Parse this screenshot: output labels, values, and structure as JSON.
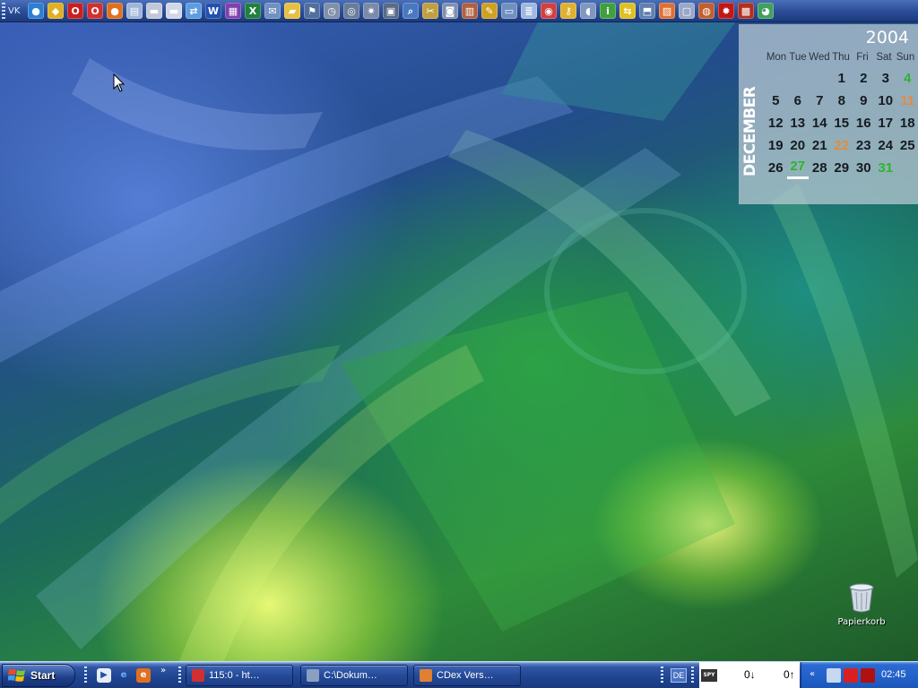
{
  "top_toolbar": {
    "label": "VK",
    "icons": [
      {
        "name": "globe-icon",
        "glyph": "●",
        "bg": "#2a7fd4"
      },
      {
        "name": "msn-icon",
        "glyph": "◆",
        "bg": "#e0b020"
      },
      {
        "name": "opera-icon",
        "glyph": "O",
        "bg": "#c82020"
      },
      {
        "name": "opera-alt-icon",
        "glyph": "O",
        "bg": "#d03030"
      },
      {
        "name": "firefox-icon",
        "glyph": "●",
        "bg": "#e07020"
      },
      {
        "name": "printer-icon",
        "glyph": "▤",
        "bg": "#9fb4d8"
      },
      {
        "name": "drive-icon",
        "glyph": "▬",
        "bg": "#c0c8d8"
      },
      {
        "name": "cd-drive-icon",
        "glyph": "▬",
        "bg": "#d0d8e8"
      },
      {
        "name": "network-icon",
        "glyph": "⇄",
        "bg": "#5e9ce0"
      },
      {
        "name": "word-icon",
        "glyph": "W",
        "bg": "#2050b0"
      },
      {
        "name": "onenote-icon",
        "glyph": "▦",
        "bg": "#8040b0"
      },
      {
        "name": "excel-icon",
        "glyph": "X",
        "bg": "#208040"
      },
      {
        "name": "mail-icon",
        "glyph": "✉",
        "bg": "#7090c0"
      },
      {
        "name": "folder-icon",
        "glyph": "▰",
        "bg": "#e8c040"
      },
      {
        "name": "flag-icon",
        "glyph": "⚑",
        "bg": "#5070a0"
      },
      {
        "name": "clock-icon",
        "glyph": "◷",
        "bg": "#8090a8"
      },
      {
        "name": "power-icon",
        "glyph": "◎",
        "bg": "#6a7c98"
      },
      {
        "name": "settings-icon",
        "glyph": "✷",
        "bg": "#7a8aa8"
      },
      {
        "name": "media-icon",
        "glyph": "▣",
        "bg": "#5a6a88"
      },
      {
        "name": "search-icon",
        "glyph": "⌕",
        "bg": "#4a78c0"
      },
      {
        "name": "tools-icon",
        "glyph": "✂",
        "bg": "#c0a040"
      },
      {
        "name": "camera-icon",
        "glyph": "◙",
        "bg": "#8090b0"
      },
      {
        "name": "books-icon",
        "glyph": "▥",
        "bg": "#b06040"
      },
      {
        "name": "paint-icon",
        "glyph": "✎",
        "bg": "#d0a020"
      },
      {
        "name": "scanner-icon",
        "glyph": "▭",
        "bg": "#7090c0"
      },
      {
        "name": "notepad-icon",
        "glyph": "≣",
        "bg": "#a0b8e0"
      },
      {
        "name": "paint-palette-icon",
        "glyph": "◉",
        "bg": "#d04040"
      },
      {
        "name": "keys-icon",
        "glyph": "⚷",
        "bg": "#e0b030"
      },
      {
        "name": "bottle-icon",
        "glyph": "◖",
        "bg": "#8098c0"
      },
      {
        "name": "info-icon",
        "glyph": "i",
        "bg": "#40a040"
      },
      {
        "name": "arrows-icon",
        "glyph": "⇆",
        "bg": "#e0c020"
      },
      {
        "name": "install-icon",
        "glyph": "⬒",
        "bg": "#6080b0"
      },
      {
        "name": "photo-icon",
        "glyph": "▨",
        "bg": "#e07030"
      },
      {
        "name": "computer-icon",
        "glyph": "▢",
        "bg": "#9aa8c8"
      },
      {
        "name": "disc-burner-icon",
        "glyph": "◍",
        "bg": "#c06030"
      },
      {
        "name": "ladybug-icon",
        "glyph": "✹",
        "bg": "#c01818"
      },
      {
        "name": "film-icon",
        "glyph": "▩",
        "bg": "#b03020"
      },
      {
        "name": "chrome-icon",
        "glyph": "◕",
        "bg": "#40a060"
      }
    ]
  },
  "calendar": {
    "year": "2004",
    "month": "DECEMBER",
    "weekdays": [
      "Mon",
      "Tue",
      "Wed",
      "Thu",
      "Fri",
      "Sat",
      "Sun"
    ],
    "leading_blanks": 3,
    "days": [
      {
        "d": "1"
      },
      {
        "d": "2"
      },
      {
        "d": "3"
      },
      {
        "d": "4",
        "style": "green"
      },
      {
        "d": "5"
      },
      {
        "d": "6"
      },
      {
        "d": "7"
      },
      {
        "d": "8"
      },
      {
        "d": "9"
      },
      {
        "d": "10"
      },
      {
        "d": "11",
        "style": "orange"
      },
      {
        "d": "12"
      },
      {
        "d": "13"
      },
      {
        "d": "14"
      },
      {
        "d": "15"
      },
      {
        "d": "16"
      },
      {
        "d": "17"
      },
      {
        "d": "18"
      },
      {
        "d": "19"
      },
      {
        "d": "20"
      },
      {
        "d": "21"
      },
      {
        "d": "22",
        "style": "orange"
      },
      {
        "d": "23"
      },
      {
        "d": "24"
      },
      {
        "d": "25"
      },
      {
        "d": "26"
      },
      {
        "d": "27",
        "style": "green-today"
      },
      {
        "d": "28"
      },
      {
        "d": "29"
      },
      {
        "d": "30"
      },
      {
        "d": "31",
        "style": "green"
      }
    ]
  },
  "desktop": {
    "recycle_bin_label": "Papierkorb"
  },
  "taskbar": {
    "start_label": "Start",
    "quick_launch": [
      {
        "name": "media-player-icon",
        "glyph": "▶",
        "bg": "#e8eef8",
        "color": "#2050a0"
      },
      {
        "name": "internet-explorer-icon",
        "glyph": "e",
        "bg": "transparent",
        "color": "#6ab0ff"
      },
      {
        "name": "mozilla-icon",
        "glyph": "e",
        "bg": "#e07020",
        "color": "#fff"
      }
    ],
    "overflow_chevron": "»",
    "tasks": [
      {
        "label": "115:0 - ht…",
        "icon_color": "#d03030"
      },
      {
        "label": "C:\\Dokum…",
        "icon_color": "#8aa0c0"
      },
      {
        "label": "CDex Vers…",
        "icon_color": "#e08030"
      }
    ],
    "language": "DE",
    "net_meter": {
      "logo": "SPY",
      "down": "0↓",
      "up": "0↑"
    },
    "tray": {
      "chevron": "«",
      "icons": [
        {
          "name": "network-tray-icon",
          "color": "#c8d8f0"
        },
        {
          "name": "antivirus-tray-icon",
          "color": "#d82020"
        },
        {
          "name": "ladybug-tray-icon",
          "color": "#b01010"
        }
      ],
      "clock": "02:45"
    }
  }
}
